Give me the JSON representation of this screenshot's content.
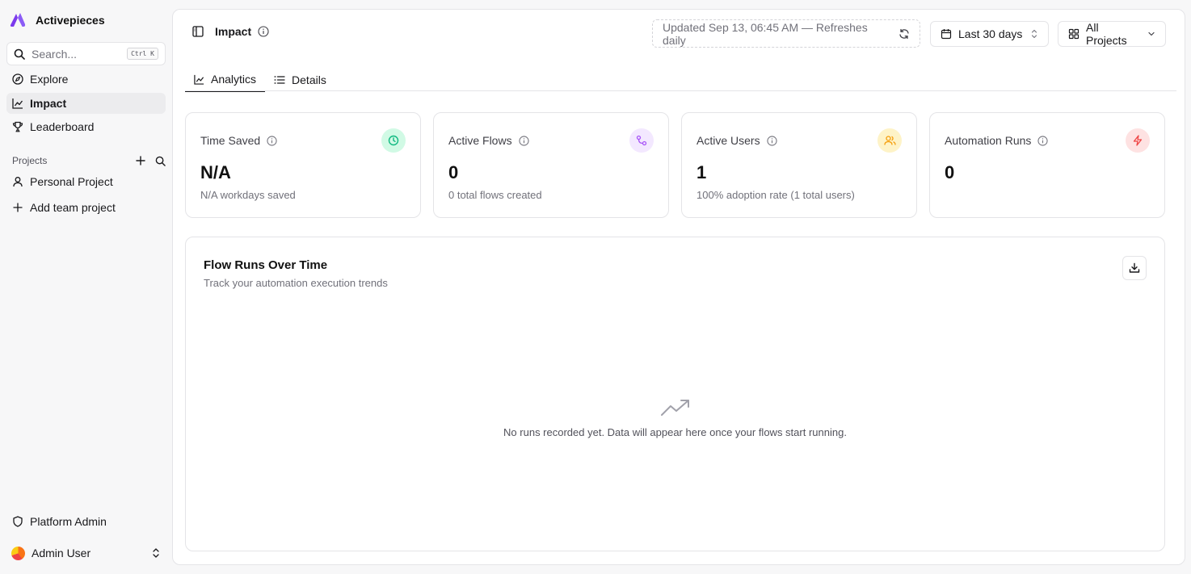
{
  "brand": {
    "name": "Activepieces",
    "color": "#7c3aed"
  },
  "search": {
    "placeholder": "Search...",
    "shortcut": "Ctrl K"
  },
  "sidebar": {
    "items": [
      {
        "label": "Explore",
        "icon": "compass-icon"
      },
      {
        "label": "Impact",
        "icon": "chart-line-icon",
        "active": true
      },
      {
        "label": "Leaderboard",
        "icon": "trophy-icon"
      }
    ],
    "projects_label": "Projects",
    "projects": [
      {
        "label": "Personal Project",
        "icon": "user-icon"
      },
      {
        "label": "Add team project",
        "icon": "plus-icon"
      }
    ],
    "platform_admin": "Platform Admin",
    "user": "Admin User"
  },
  "header": {
    "title": "Impact",
    "updated": "Updated Sep 13, 06:45 AM — Refreshes daily",
    "date_range": "Last 30 days",
    "project_filter": "All Projects"
  },
  "tabs": [
    {
      "label": "Analytics",
      "active": true
    },
    {
      "label": "Details",
      "active": false
    }
  ],
  "cards": [
    {
      "title": "Time Saved",
      "value": "N/A",
      "sub": "N/A workdays saved",
      "icon": "clock-icon",
      "color": "#10b981",
      "bg": "#dcfce7"
    },
    {
      "title": "Active Flows",
      "value": "0",
      "sub": "0 total flows created",
      "icon": "workflow-icon",
      "color": "#a855f7",
      "bg": "#f3e8ff"
    },
    {
      "title": "Active Users",
      "value": "1",
      "sub": "100% adoption rate (1 total users)",
      "icon": "users-icon",
      "color": "#f59e0b",
      "bg": "#fef3c7"
    },
    {
      "title": "Automation Runs",
      "value": "0",
      "sub": "",
      "icon": "zap-icon",
      "color": "#ef4444",
      "bg": "#fee2e2"
    }
  ],
  "chart": {
    "title": "Flow Runs Over Time",
    "subtitle": "Track your automation execution trends",
    "empty_message": "No runs recorded yet. Data will appear here once your flows start running."
  }
}
